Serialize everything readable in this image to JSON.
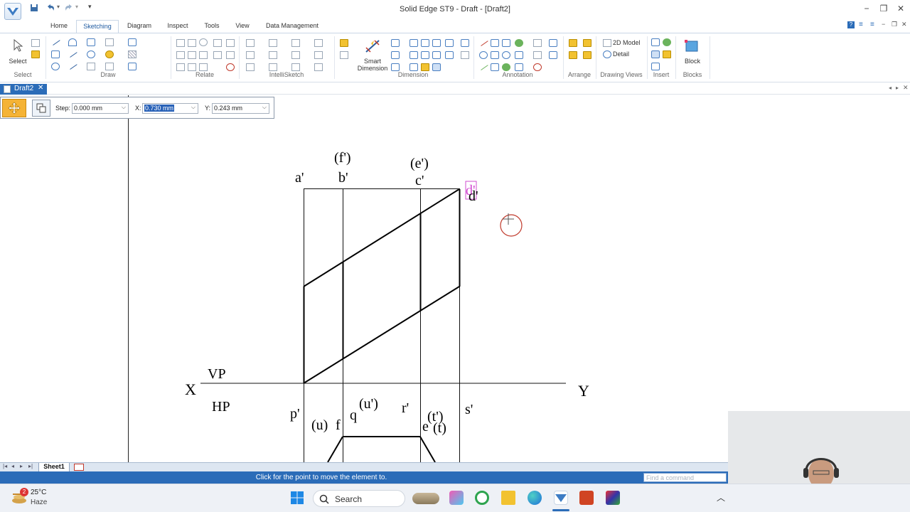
{
  "window": {
    "title": "Solid Edge ST9 - Draft - [Draft2]",
    "minimize": "−",
    "restore": "❐",
    "close": "✕"
  },
  "ribbon": {
    "tabs": [
      "Home",
      "Sketching",
      "Diagram",
      "Inspect",
      "Tools",
      "View",
      "Data Management"
    ],
    "active_tab": "Sketching",
    "groups": [
      "Select",
      "Draw",
      "Relate",
      "IntelliSketch",
      "Dimension",
      "Annotation",
      "Arrange",
      "Drawing Views",
      "Insert",
      "Blocks"
    ],
    "select_label": "Select",
    "smart_dimension_label_1": "Smart",
    "smart_dimension_label_2": "Dimension",
    "model_2d_label": "2D Model",
    "detail_label": "Detail",
    "block_label": "Block"
  },
  "document_tab": {
    "label": "Draft2",
    "close": "✕"
  },
  "command_bar": {
    "step_label": "Step:",
    "step_value": "0.000 mm",
    "x_label": "X:",
    "x_value": "0.730 mm",
    "y_label": "Y:",
    "y_value": "0.243 mm"
  },
  "drawing": {
    "labels": {
      "a_prime": "a'",
      "f_prime_paren": "(f')",
      "b_prime": "b'",
      "e_prime_paren": "(e')",
      "c_prime": "c'",
      "d_prime_highlight": "d'",
      "d_prime": "d'",
      "x": "X",
      "y": "Y",
      "vp": "VP",
      "hp": "HP",
      "p_prime": "p'",
      "u_paren": "(u)",
      "f": "f",
      "q": "q",
      "u_prime_paren": "(u')",
      "r_prime": "r'",
      "t_prime_paren": "(t')",
      "e": "e",
      "t_paren": "(t)",
      "s_prime": "s'"
    }
  },
  "sheet_tab": "Sheet1",
  "status": {
    "message": "Click for the point to move the element to.",
    "find_placeholder": "Find a command"
  },
  "taskbar": {
    "weather_badge": "2",
    "temperature": "25°C",
    "condition": "Haze",
    "search": "Search",
    "tray_chevron": "︿"
  }
}
